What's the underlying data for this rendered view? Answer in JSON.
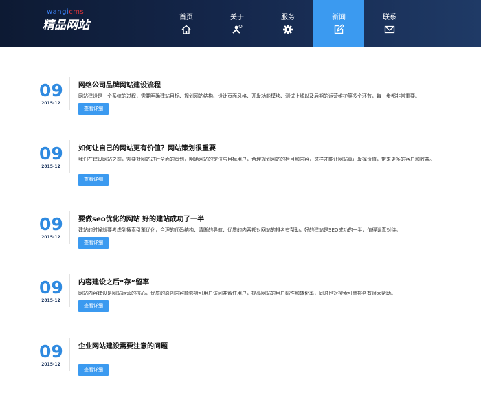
{
  "logo": {
    "small_prefix": "wangi",
    "small_highlight": "cms",
    "main": "精品网站"
  },
  "nav": {
    "items": [
      {
        "label": "首页",
        "icon": "home-icon"
      },
      {
        "label": "关于",
        "icon": "about-icon"
      },
      {
        "label": "服务",
        "icon": "gear-icon"
      },
      {
        "label": "新闻",
        "icon": "edit-icon",
        "active": true
      },
      {
        "label": "联系",
        "icon": "mail-icon"
      }
    ]
  },
  "colors": {
    "accent": "#3b9af0",
    "date_blue": "#2f8ae0",
    "header_dark": "#0d1a33"
  },
  "news": [
    {
      "day": "09",
      "ym": "2015-12",
      "title": "网络公司品牌网站建设流程",
      "excerpt": "网站建设是一个系统的过程，需要明确建站目标、规划网站结构、设计页面风格、开发功能模块、测试上线以及后期的运营维护等多个环节，每一步都非常重要。",
      "button": "查看详细"
    },
    {
      "day": "09",
      "ym": "2015-12",
      "title": "如何让自己的网站更有价值？网站策划很重要",
      "excerpt": "我们在建设网站之前，需要对网站进行全面的策划，明确网站的定位与目标用户，合理规划网站的栏目和内容，这样才能让网站真正发挥价值，带来更多的客户和收益。",
      "button": "查看详细"
    },
    {
      "day": "09",
      "ym": "2015-12",
      "title": "要做seo优化的网站 好的建站成功了一半",
      "excerpt": "建站的时候就要考虑到搜索引擎优化，合理的代码结构、清晰的导航、优质的内容都对网站的排名有帮助，好的建站是SEO成功的一半，值得认真对待。",
      "button": "查看详细"
    },
    {
      "day": "09",
      "ym": "2015-12",
      "title": "内容建设之后“存”留率",
      "excerpt": "网站内容建设是网站运营的核心，优质的原创内容能够吸引用户访问并留住用户，提高网站的用户黏性和转化率，同时也对搜索引擎排名有很大帮助。",
      "button": "查看详细"
    },
    {
      "day": "09",
      "ym": "2015-12",
      "title": "企业网站建设需要注意的问题",
      "excerpt": "",
      "button": "查看详细"
    }
  ]
}
